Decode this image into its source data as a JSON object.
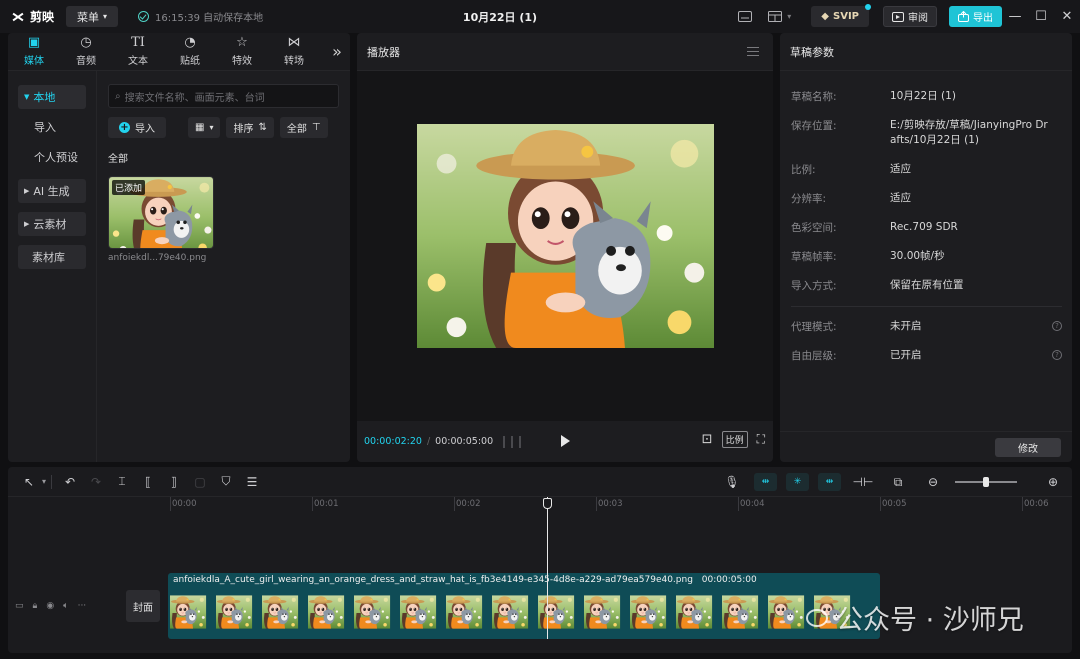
{
  "app": {
    "logo_text": "剪映",
    "menu_label": "菜单",
    "autosave_text": "16:15:39 自动保存本地",
    "doc_title": "10月22日 (1)",
    "svip_label": "SVIP",
    "review_label": "审阅",
    "export_label": "导出",
    "accent_color": "#22d3ee"
  },
  "media": {
    "tabs": [
      {
        "label": "媒体",
        "icon": "media-icon",
        "active": true
      },
      {
        "label": "音频",
        "icon": "audio-icon"
      },
      {
        "label": "文本",
        "icon": "text-icon"
      },
      {
        "label": "贴纸",
        "icon": "sticker-icon"
      },
      {
        "label": "特效",
        "icon": "effects-icon"
      },
      {
        "label": "转场",
        "icon": "transition-icon"
      }
    ],
    "sidebar": [
      {
        "label": "本地",
        "active": true
      },
      {
        "label": "导入"
      },
      {
        "label": "个人预设"
      },
      {
        "label": "AI 生成"
      },
      {
        "label": "云素材"
      },
      {
        "label": "素材库"
      }
    ],
    "search_placeholder": "搜索文件名称、画面元素、台词",
    "import_label": "导入",
    "sort_label": "排序",
    "filter_label": "全部",
    "section_label": "全部",
    "asset": {
      "badge": "已添加",
      "name": "anfoiekdl...79e40.png"
    }
  },
  "player": {
    "title": "播放器",
    "current_time": "00:00:02:20",
    "total_time": "00:00:05:00",
    "ratio_label": "比例"
  },
  "params": {
    "title": "草稿参数",
    "rows": [
      {
        "key": "草稿名称:",
        "value": "10月22日 (1)"
      },
      {
        "key": "保存位置:",
        "value": "E:/剪映存放/草稿/JianyingPro Drafts/10月22日 (1)"
      },
      {
        "key": "比例:",
        "value": "适应"
      },
      {
        "key": "分辨率:",
        "value": "适应"
      },
      {
        "key": "色彩空间:",
        "value": "Rec.709 SDR"
      },
      {
        "key": "草稿帧率:",
        "value": "30.00帧/秒"
      },
      {
        "key": "导入方式:",
        "value": "保留在原有位置"
      }
    ],
    "extra_rows": [
      {
        "key": "代理模式:",
        "value": "未开启"
      },
      {
        "key": "自由层级:",
        "value": "已开启"
      }
    ],
    "modify_label": "修改"
  },
  "timeline": {
    "ticks": [
      "00:00",
      "00:01",
      "00:02",
      "00:03",
      "00:04",
      "00:05",
      "00:06"
    ],
    "cover_label": "封面",
    "clip_name": "anfoiekdla_A_cute_girl_wearing_an_orange_dress_and_straw_hat_is_fb3e4149-e345-4d8e-a229-ad79ea579e40.png",
    "clip_duration": "00:00:05:00"
  },
  "watermark": "公众号 · 沙师兄"
}
